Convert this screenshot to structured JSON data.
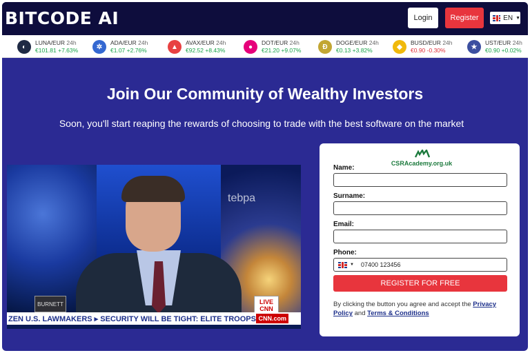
{
  "header": {
    "logo": "BITCODE AI",
    "login_label": "Login",
    "register_label": "Register",
    "lang_label": "EN"
  },
  "ticker": [
    {
      "pair": "LUNA/EUR",
      "period": "24h",
      "price": "€101.81",
      "change": "+7.63%",
      "icon": "luna-icon",
      "color": "#1f2a44",
      "trend": "pos"
    },
    {
      "pair": "ADA/EUR",
      "period": "24h",
      "price": "€1.07",
      "change": "+2.76%",
      "icon": "cardano-icon",
      "color": "#3468d1",
      "trend": "pos"
    },
    {
      "pair": "AVAX/EUR",
      "period": "24h",
      "price": "€92.52",
      "change": "+8.43%",
      "icon": "avalanche-icon",
      "color": "#e84142",
      "trend": "pos"
    },
    {
      "pair": "DOT/EUR",
      "period": "24h",
      "price": "€21.20",
      "change": "+9.07%",
      "icon": "polkadot-icon",
      "color": "#e6007a",
      "trend": "pos"
    },
    {
      "pair": "DOGE/EUR",
      "period": "24h",
      "price": "€0.13",
      "change": "+3.82%",
      "icon": "dogecoin-icon",
      "color": "#c2a633",
      "trend": "pos"
    },
    {
      "pair": "BUSD/EUR",
      "period": "24h",
      "price": "€0.90",
      "change": "-0.30%",
      "icon": "busd-icon",
      "color": "#f0b90b",
      "trend": "neg"
    },
    {
      "pair": "UST/EUR",
      "period": "24h",
      "price": "€0.90",
      "change": "+0.02%",
      "icon": "us-flag-icon",
      "color": "#3c4fa0",
      "trend": "pos"
    }
  ],
  "hero": {
    "title": "Join Our Community of Wealthy Investors",
    "subtitle": "Soon, you'll start reaping the rewards of choosing to trade with the best software on the market"
  },
  "video": {
    "name_tag": "BURNETT",
    "live_label": "LIVE",
    "network": "CNN",
    "crawl_text": "ZEN U.S. LAWMAKERS  ▸  SECURITY WILL BE TIGHT: ELITE TROOPS,",
    "site": "CNN.com",
    "backdrop_text": "tebpa"
  },
  "form": {
    "watermark": "CSRAcademy.org.uk",
    "name_label": "Name:",
    "surname_label": "Surname:",
    "email_label": "Email:",
    "phone_label": "Phone:",
    "phone_placeholder": "07400 123456",
    "submit_label": "REGISTER FOR FREE",
    "legal_prefix": "By clicking the button you agree and accept the ",
    "privacy_label": "Privacy Policy",
    "legal_and": " and ",
    "terms_label": "Terms & Conditions"
  }
}
